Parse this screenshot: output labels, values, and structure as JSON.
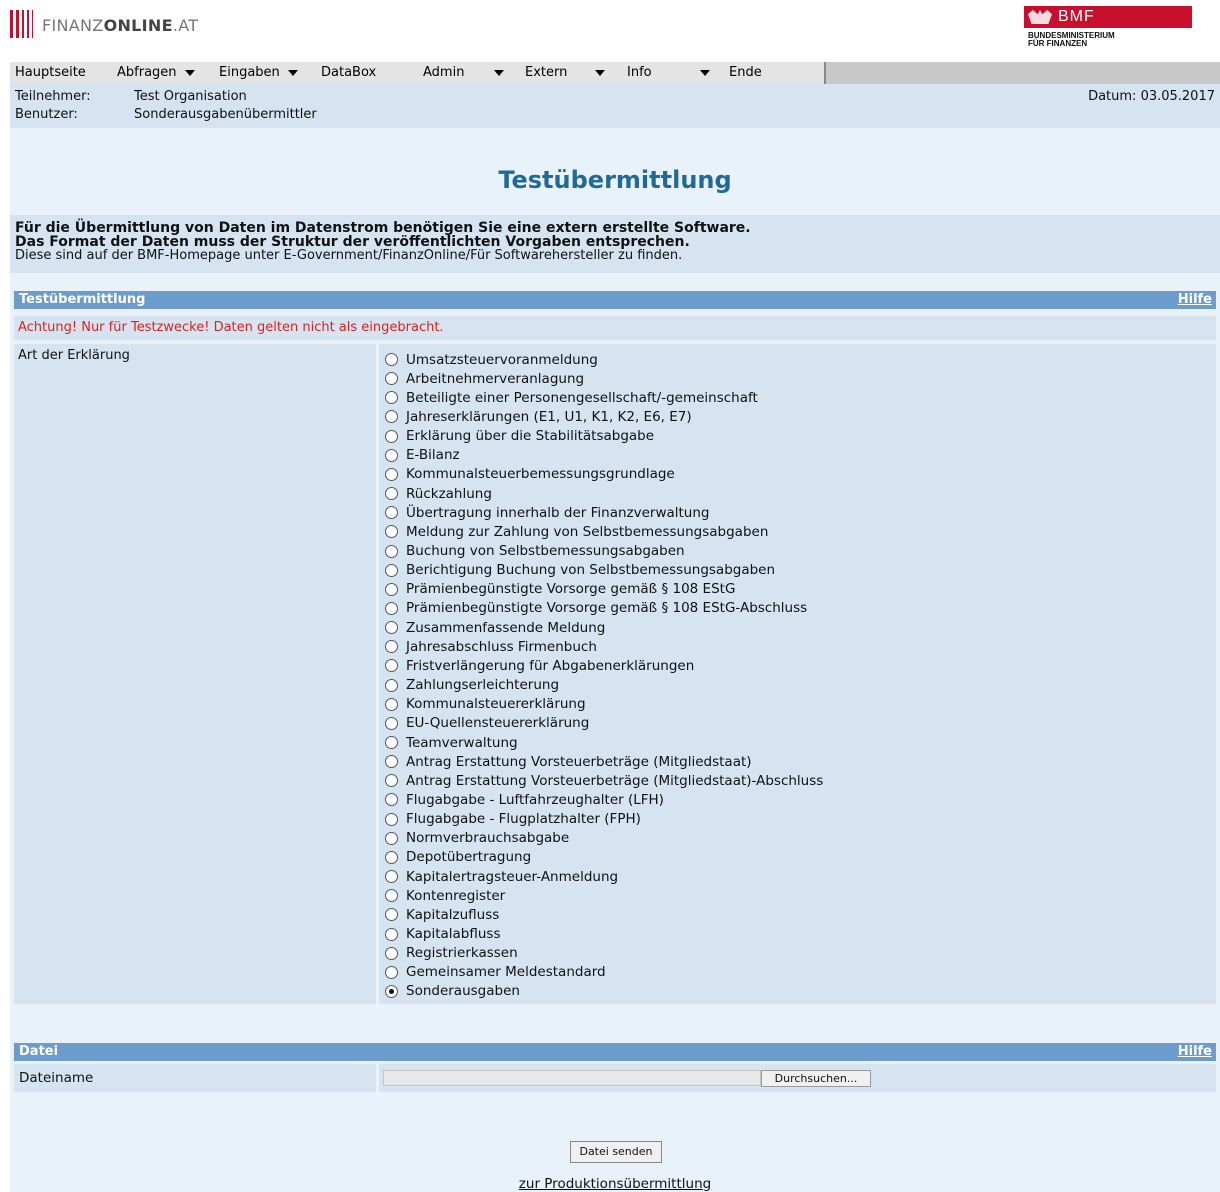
{
  "header": {
    "brand_light": "FINANZ",
    "brand_bold": "ONLINE",
    "brand_suffix": ".AT",
    "bmf_word": "BMF",
    "bmf_line1": "BUNDESMINISTERIUM",
    "bmf_line2": "FÜR FINANZEN"
  },
  "nav": {
    "items": [
      "Hauptseite",
      "Abfragen",
      "Eingaben",
      "DataBox",
      "Admin",
      "Extern",
      "Info",
      "Ende"
    ]
  },
  "info": {
    "teilnehmer_label": "Teilnehmer:",
    "teilnehmer_value": "Test Organisation",
    "benutzer_label": "Benutzer:",
    "benutzer_value": "Sonderausgabenübermittler",
    "datum": "Datum: 03.05.2017"
  },
  "page_title": "Testübermittlung",
  "intro": {
    "line1": "Für die Übermittlung von Daten im Datenstrom benötigen Sie eine extern erstellte Software.",
    "line2": "Das Format der Daten muss der Struktur der veröffentlichten Vorgaben entsprechen.",
    "line3": "Diese sind auf der BMF-Homepage unter E-Government/FinanzOnline/Für Softwarehersteller zu finden."
  },
  "section_test": {
    "title": "Testübermittlung",
    "help": "Hilfe",
    "warning": "Achtung! Nur für Testzwecke! Daten gelten nicht als eingebracht.",
    "field_label": "Art der Erklärung",
    "selected": "Sonderausgaben",
    "options": [
      "Umsatzsteuervoranmeldung",
      "Arbeitnehmerveranlagung",
      "Beteiligte einer Personengesellschaft/-gemeinschaft",
      "Jahreserklärungen (E1, U1, K1, K2, E6, E7)",
      "Erklärung über die Stabilitätsabgabe",
      "E-Bilanz",
      "Kommunalsteuerbemessungsgrundlage",
      "Rückzahlung",
      "Übertragung innerhalb der Finanzverwaltung",
      "Meldung zur Zahlung von Selbstbemessungsabgaben",
      "Buchung von Selbstbemessungsabgaben",
      "Berichtigung Buchung von Selbstbemessungsabgaben",
      "Prämienbegünstigte Vorsorge gemäß § 108 EStG",
      "Prämienbegünstigte Vorsorge gemäß § 108 EStG-Abschluss",
      "Zusammenfassende Meldung",
      "Jahresabschluss Firmenbuch",
      "Fristverlängerung für Abgabenerklärungen",
      "Zahlungserleichterung",
      "Kommunalsteuererklärung",
      "EU-Quellensteuererklärung",
      "Teamverwaltung",
      "Antrag Erstattung Vorsteuerbeträge (Mitgliedstaat)",
      "Antrag Erstattung Vorsteuerbeträge (Mitgliedstaat)-Abschluss",
      "Flugabgabe - Luftfahrzeughalter (LFH)",
      "Flugabgabe - Flugplatzhalter (FPH)",
      "Normverbrauchsabgabe",
      "Depotübertragung",
      "Kapitalertragsteuer-Anmeldung",
      "Kontenregister",
      "Kapitalzufluss",
      "Kapitalabfluss",
      "Registrierkassen",
      "Gemeinsamer Meldestandard",
      "Sonderausgaben"
    ]
  },
  "section_datei": {
    "title": "Datei",
    "help": "Hilfe",
    "field_label": "Dateiname",
    "file_value": "",
    "browse_label": "Durchsuchen..."
  },
  "send_label": "Datei senden",
  "prod_link": "zur Produktionsübermittlung"
}
